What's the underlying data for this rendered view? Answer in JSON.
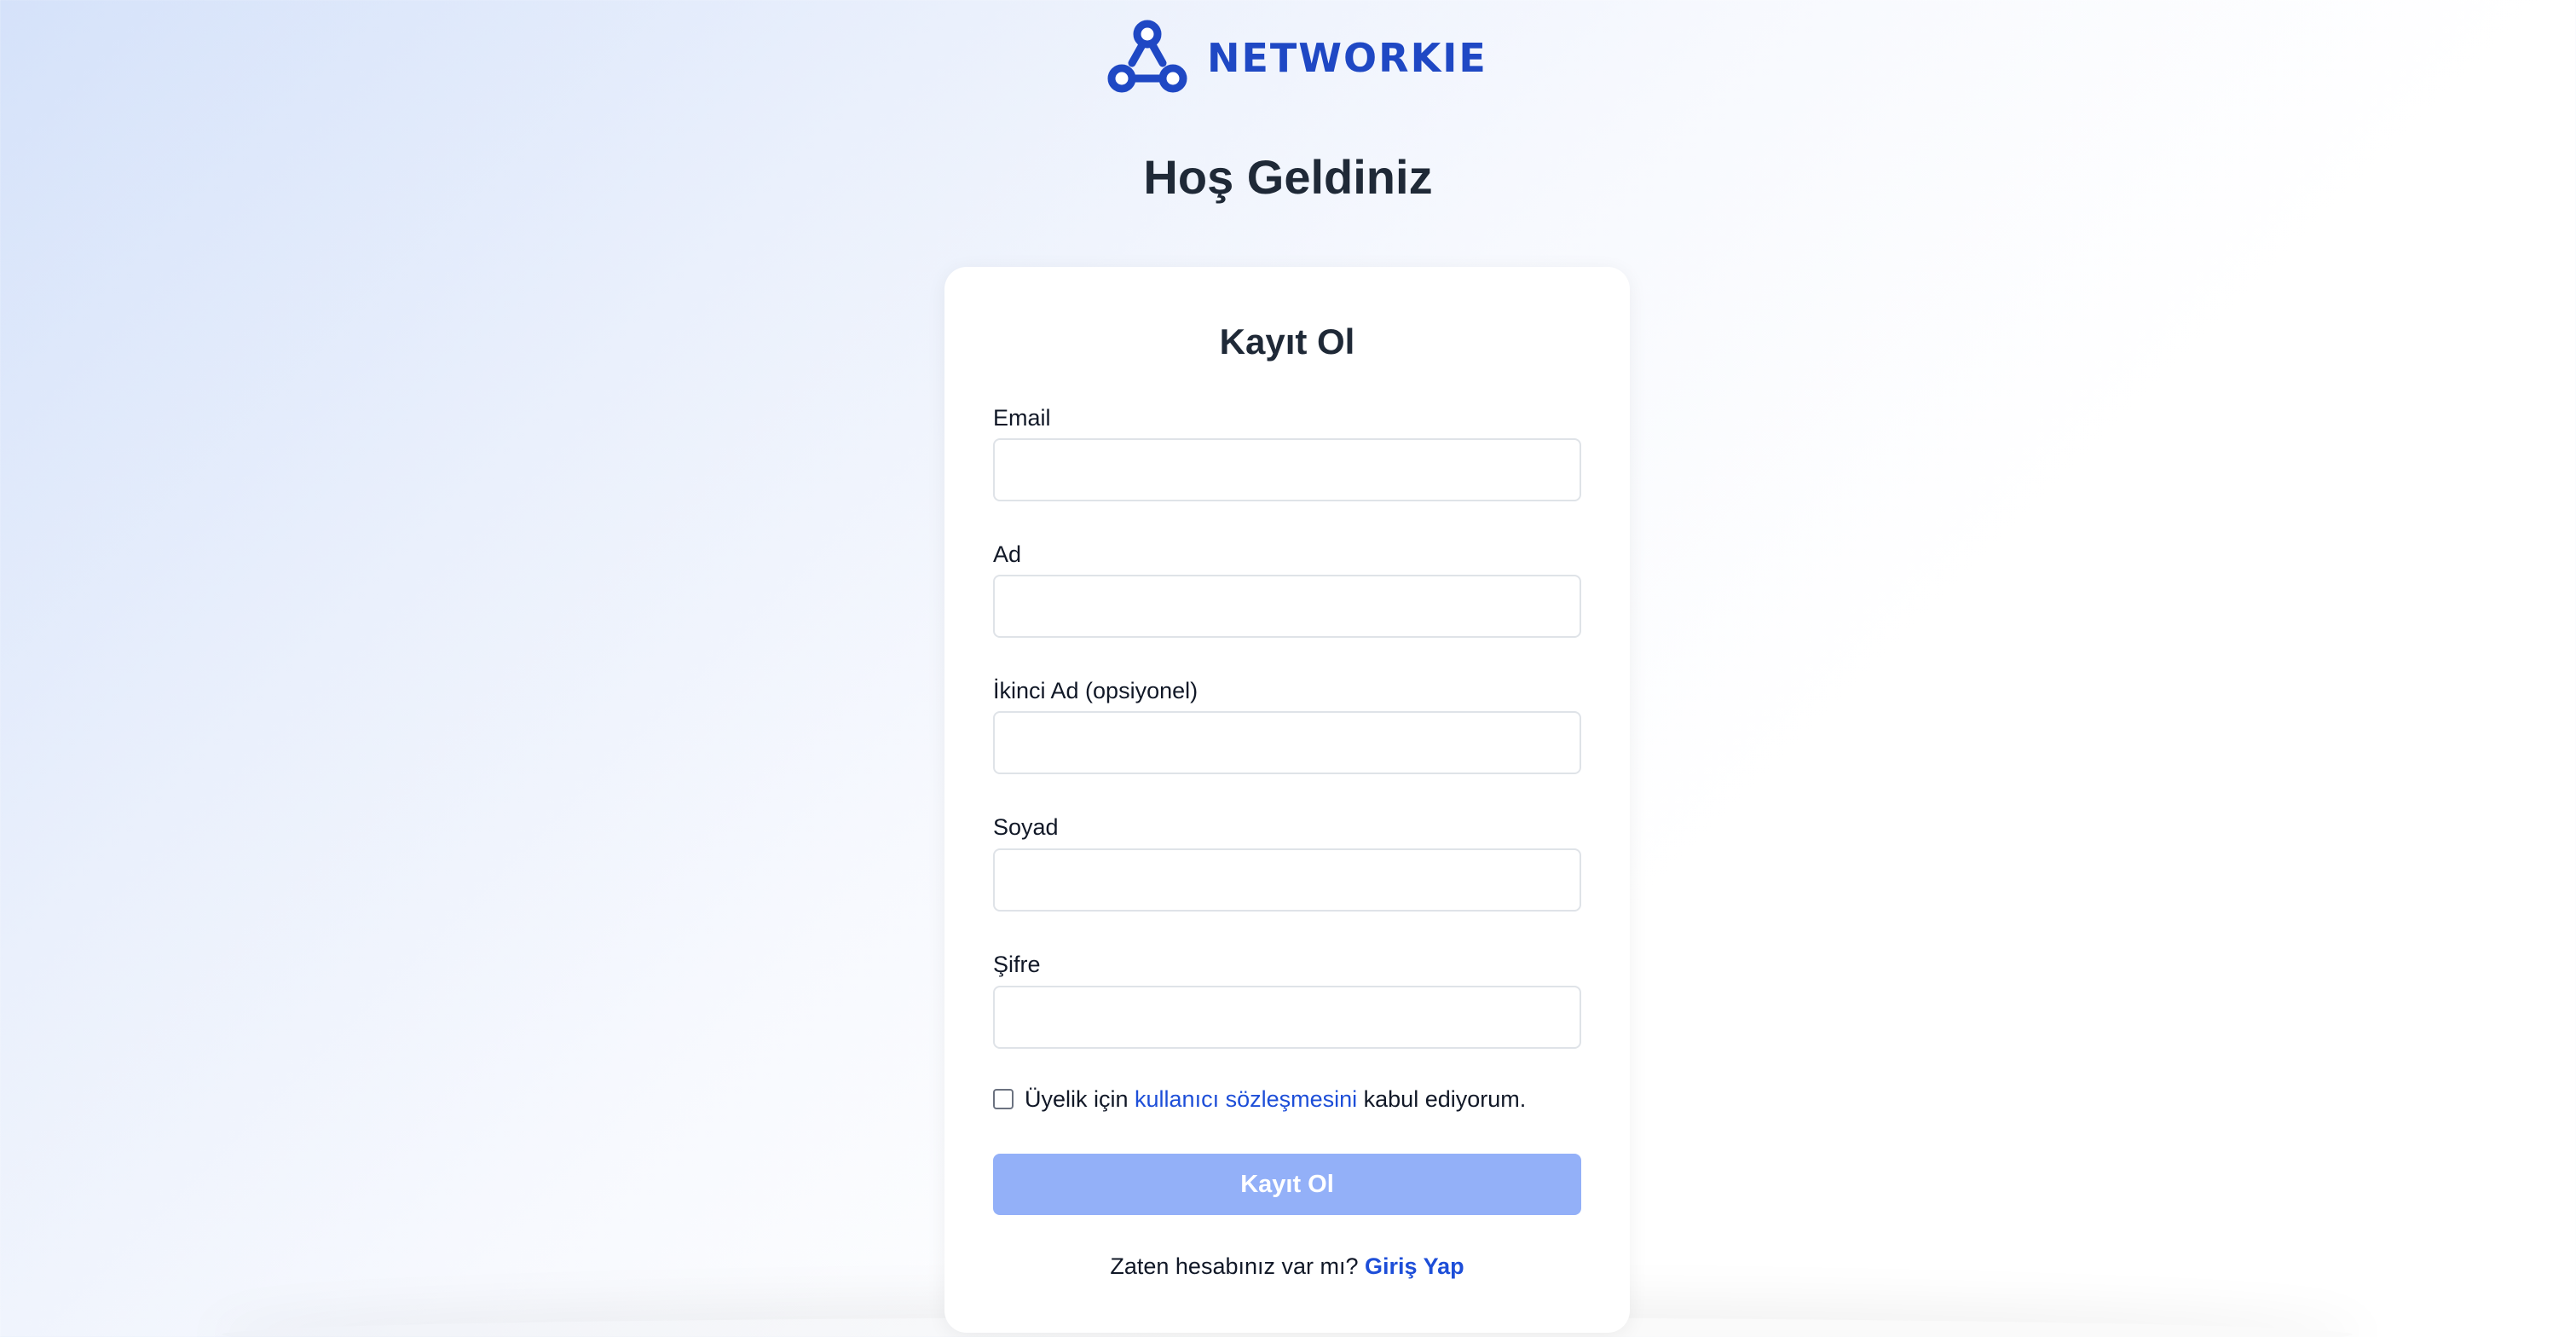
{
  "brand": {
    "name": "NETWORKIE",
    "color": "#1f48c4"
  },
  "welcome_title": "Hoş Geldiniz",
  "form": {
    "title": "Kayıt Ol",
    "fields": [
      {
        "label": "Email",
        "value": "",
        "placeholder": ""
      },
      {
        "label": "Ad",
        "value": "",
        "placeholder": ""
      },
      {
        "label": "İkinci Ad (opsiyonel)",
        "value": "",
        "placeholder": ""
      },
      {
        "label": "Soyad",
        "value": "",
        "placeholder": ""
      },
      {
        "label": "Şifre",
        "value": "",
        "placeholder": ""
      }
    ],
    "terms": {
      "checked": false,
      "prefix": "Üyelik için ",
      "link": "kullanıcı sözleşmesini",
      "suffix": " kabul ediyorum."
    },
    "submit_label": "Kayıt Ol",
    "submit_color": "#93b0f8",
    "login_prompt": "Zaten hesabınız var mı? ",
    "login_link": "Giriş Yap"
  }
}
